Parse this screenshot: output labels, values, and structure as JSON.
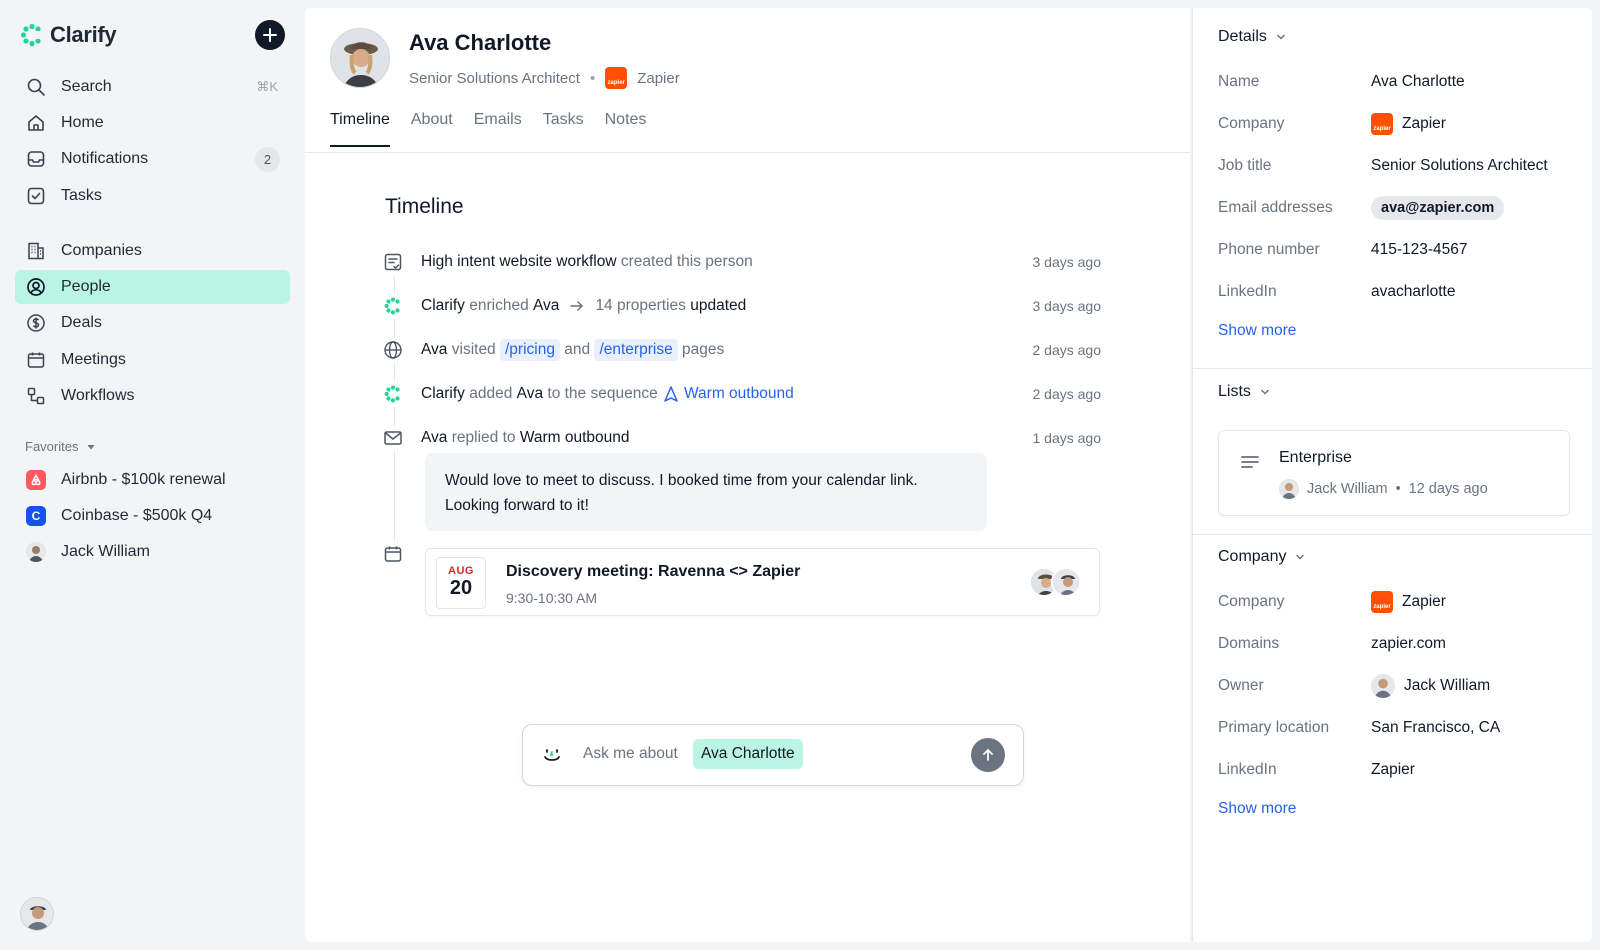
{
  "app": {
    "name": "Clarify"
  },
  "sidebar": {
    "search": {
      "label": "Search",
      "shortcut": "⌘K"
    },
    "items": [
      {
        "label": "Home"
      },
      {
        "label": "Notifications",
        "badge": "2"
      },
      {
        "label": "Tasks"
      },
      {
        "label": "Companies"
      },
      {
        "label": "People"
      },
      {
        "label": "Deals"
      },
      {
        "label": "Meetings"
      },
      {
        "label": "Workflows"
      }
    ],
    "favorites_title": "Favorites",
    "favorites": [
      {
        "label": "Airbnb - $100k renewal"
      },
      {
        "label": "Coinbase - $500k Q4",
        "icon_letter": "C"
      },
      {
        "label": "Jack William"
      }
    ]
  },
  "person": {
    "name": "Ava Charlotte",
    "title": "Senior Solutions Architect",
    "company": "Zapier",
    "company_logo_text": "zapier"
  },
  "tabs": [
    "Timeline",
    "About",
    "Emails",
    "Tasks",
    "Notes"
  ],
  "timeline": {
    "title": "Timeline",
    "rows": [
      {
        "parts": [
          "High intent website workflow",
          " created this person"
        ],
        "time": "3 days ago"
      },
      {
        "parts": [
          "Clarify",
          " enriched ",
          "Ava",
          "14 properties",
          " updated"
        ],
        "time": "3 days ago"
      },
      {
        "parts": [
          "Ava",
          " visited ",
          "/pricing",
          " and ",
          "/enterprise",
          " pages"
        ],
        "time": "2 days ago"
      },
      {
        "parts": [
          "Clarify",
          " added ",
          "Ava",
          " to the sequence ",
          "Warm outbound"
        ],
        "time": "2 days ago"
      },
      {
        "parts": [
          "Ava",
          " replied to ",
          "Warm outbound"
        ],
        "time": "1 days ago"
      }
    ],
    "quote": "Would love to meet to discuss. I booked time from your calendar link. Looking forward to it!",
    "meeting": {
      "month": "AUG",
      "day": "20",
      "title": "Discovery meeting: Ravenna <> Zapier",
      "time": "9:30-10:30 AM"
    }
  },
  "ask": {
    "prefix": "Ask me about",
    "chip": "Ava Charlotte"
  },
  "details": {
    "title": "Details",
    "rows": [
      {
        "label": "Name",
        "value": "Ava Charlotte"
      },
      {
        "label": "Company",
        "value": "Zapier"
      },
      {
        "label": "Job title",
        "value": "Senior Solutions Architect"
      },
      {
        "label": "Email addresses",
        "value": "ava@zapier.com"
      },
      {
        "label": "Phone number",
        "value": "415-123-4567"
      },
      {
        "label": "LinkedIn",
        "value": "avacharlotte"
      }
    ],
    "show_more": "Show more"
  },
  "lists": {
    "title": "Lists",
    "card": {
      "title": "Enterprise",
      "owner": "Jack William",
      "time": "12 days ago"
    }
  },
  "company": {
    "title": "Company",
    "rows": [
      {
        "label": "Company",
        "value": "Zapier"
      },
      {
        "label": "Domains",
        "value": "zapier.com"
      },
      {
        "label": "Owner",
        "value": "Jack William"
      },
      {
        "label": "Primary location",
        "value": "San Francisco, CA"
      },
      {
        "label": "LinkedIn",
        "value": "Zapier"
      }
    ],
    "show_more": "Show more"
  },
  "colors": {
    "accent": "#b9f5e2",
    "link": "#2563eb",
    "zapier": "#ff4f00",
    "airbnb": "#ff5a5f",
    "coinbase": "#1652f0"
  }
}
